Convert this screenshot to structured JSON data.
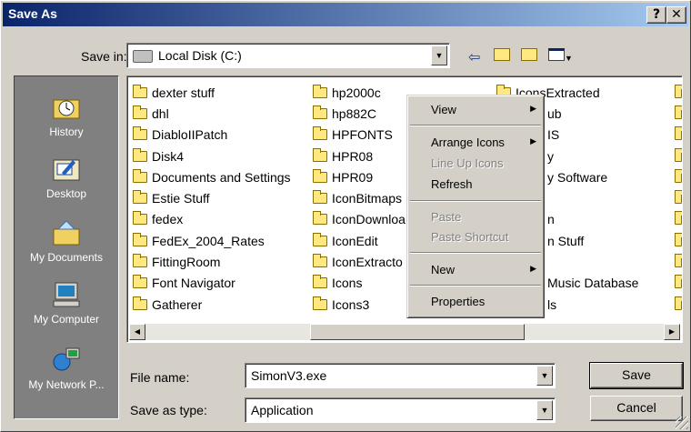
{
  "window": {
    "title": "Save As"
  },
  "titlebar": {
    "help_label": "?",
    "close_label": "✕"
  },
  "save_in": {
    "label": "Save in:",
    "value": "Local Disk (C:)"
  },
  "places": [
    {
      "label": "History",
      "icon": "history-icon"
    },
    {
      "label": "Desktop",
      "icon": "desktop-icon"
    },
    {
      "label": "My Documents",
      "icon": "my-documents-icon"
    },
    {
      "label": "My Computer",
      "icon": "my-computer-icon"
    },
    {
      "label": "My Network P...",
      "icon": "my-network-places-icon"
    }
  ],
  "files": {
    "col1": [
      "dexter stuff",
      "dhl",
      "DiabloIIPatch",
      "Disk4",
      "Documents and Settings",
      "Estie Stuff",
      "fedex",
      "FedEx_2004_Rates",
      "FittingRoom",
      "Font Navigator",
      "Gatherer"
    ],
    "col2": [
      "hp2000c",
      "hp882C",
      "HPFONTS",
      "HPR08",
      "HPR09",
      "IconBitmaps",
      "IconDownloa",
      "IconEdit",
      "IconExtracto",
      "Icons",
      "Icons3"
    ],
    "col3": [
      "IconsExtracted",
      "ub",
      "IS",
      "y",
      "y Software",
      "",
      "n",
      "n Stuff",
      "",
      "Music Database",
      "ls"
    ]
  },
  "context_menu": {
    "view": "View",
    "arrange_icons": "Arrange Icons",
    "line_up_icons": "Line Up Icons",
    "refresh": "Refresh",
    "paste": "Paste",
    "paste_shortcut": "Paste Shortcut",
    "new": "New",
    "properties": "Properties"
  },
  "file_name": {
    "label": "File name:",
    "value": "SimonV3.exe"
  },
  "save_as_type": {
    "label": "Save as type:",
    "value": "Application"
  },
  "buttons": {
    "save": "Save",
    "cancel": "Cancel"
  },
  "colors": {
    "title_start": "#0a246a",
    "title_end": "#a6caf0",
    "face": "#d4d0c8",
    "places_bg": "#808080"
  }
}
